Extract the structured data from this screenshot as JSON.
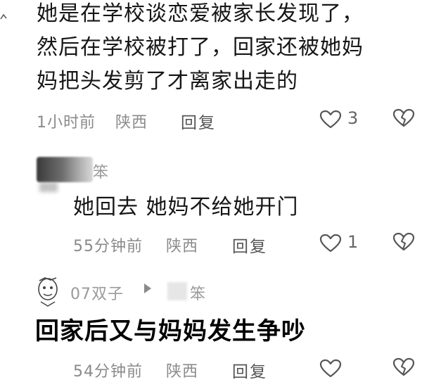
{
  "comment1": {
    "lines": [
      "她是在学校谈恋爱被家长发现了，",
      "然后在学校被打了，回家还被她妈",
      "妈把头发剪了才离家出走的"
    ],
    "time": "1小时前",
    "location": "陕西",
    "reply_label": "回复",
    "likes": "3"
  },
  "reply1": {
    "username": "笨",
    "text": "她回去 她妈不给她开门",
    "time": "55分钟前",
    "location": "陕西",
    "reply_label": "回复",
    "likes": "1"
  },
  "reply2": {
    "username": "07双子",
    "reply_to": "笨",
    "time": "54分钟前",
    "location": "陕西",
    "reply_label": "回复"
  },
  "subtitle": "回家后又与妈妈发生争吵",
  "icons": [
    "heart-icon",
    "broken-heart-icon",
    "play-arrow-icon"
  ]
}
